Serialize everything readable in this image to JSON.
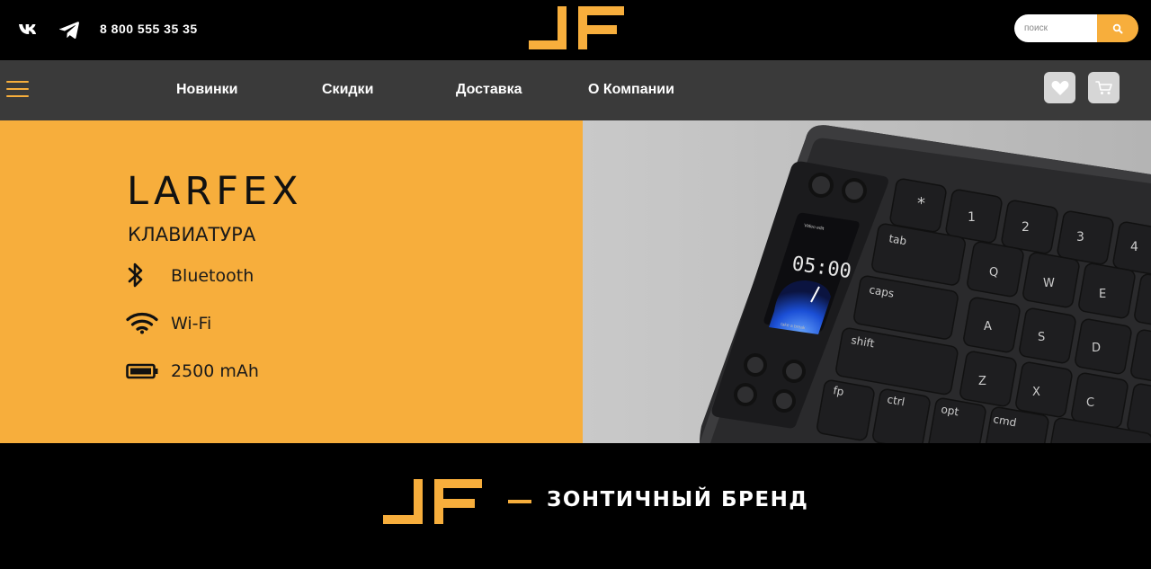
{
  "header": {
    "social": [
      {
        "name": "vk-icon"
      },
      {
        "name": "telegram-icon"
      }
    ],
    "phone": "8 800 555 35 35",
    "search": {
      "placeholder": "поиск"
    },
    "accent": "#f7ae3c"
  },
  "nav": {
    "items": [
      {
        "label": "Новинки"
      },
      {
        "label": "Скидки"
      },
      {
        "label": "Доставка"
      },
      {
        "label": "О Компании"
      }
    ]
  },
  "hero": {
    "brand": "LARFEX",
    "subtitle": "КЛАВИАТУРА",
    "features": [
      {
        "icon": "bluetooth-icon",
        "label": "Bluetooth"
      },
      {
        "icon": "wifi-icon",
        "label": "Wi-Fi"
      },
      {
        "icon": "battery-icon",
        "label": "2500 mAh"
      }
    ],
    "keyboard": {
      "screen_time": "05:00",
      "screen_title": "Video edit",
      "screen_caption": "take a break",
      "mod_keys": [
        "tab",
        "caps",
        "shift",
        "fp",
        "ctrl",
        "opt",
        "cmd"
      ],
      "num_keys": [
        "1",
        "2",
        "3",
        "4"
      ],
      "row_q": [
        "Q",
        "W",
        "E"
      ],
      "row_a": [
        "A",
        "S",
        "D"
      ],
      "row_z": [
        "Z",
        "X",
        "C"
      ]
    }
  },
  "footer_banner": {
    "dash": "—",
    "tagline": "ЗОНТИЧНЫЙ БРЕНД"
  }
}
